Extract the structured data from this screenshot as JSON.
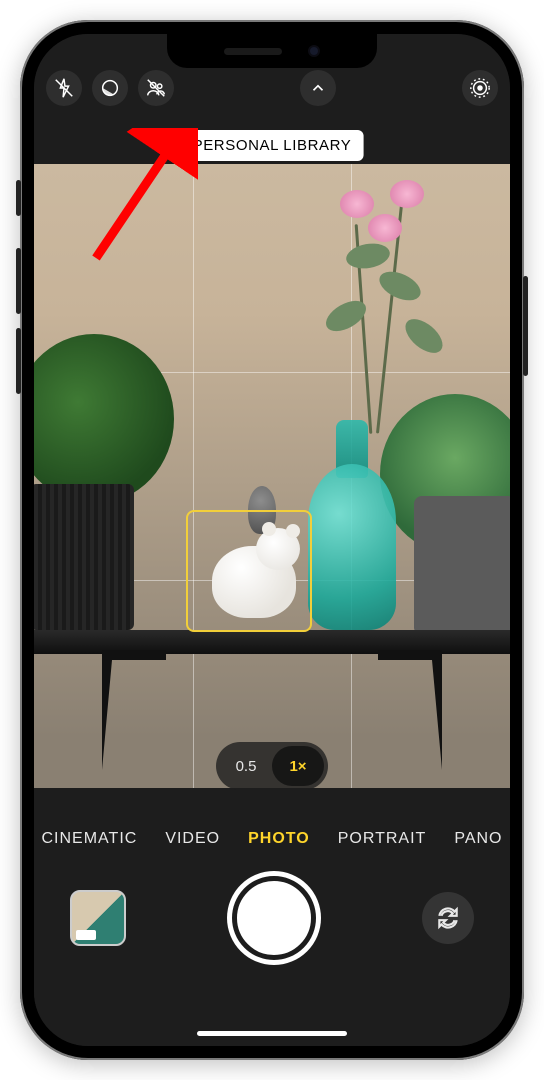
{
  "library_pill": "PERSONAL LIBRARY",
  "zoom": {
    "options": [
      "0.5",
      "1×"
    ],
    "selected_index": 1
  },
  "modes": {
    "items": [
      "CINEMATIC",
      "VIDEO",
      "PHOTO",
      "PORTRAIT",
      "PANO"
    ],
    "selected_index": 2
  },
  "topbar_icons": {
    "flash": "flash-off-icon",
    "night": "night-mode-icon",
    "shared_library": "shared-library-off-icon",
    "expand": "chevron-up-icon",
    "live": "live-photo-icon"
  },
  "colors": {
    "accent": "#ffd52b",
    "focus_box": "#f2cf3a",
    "annotation_arrow": "#ff0000"
  }
}
